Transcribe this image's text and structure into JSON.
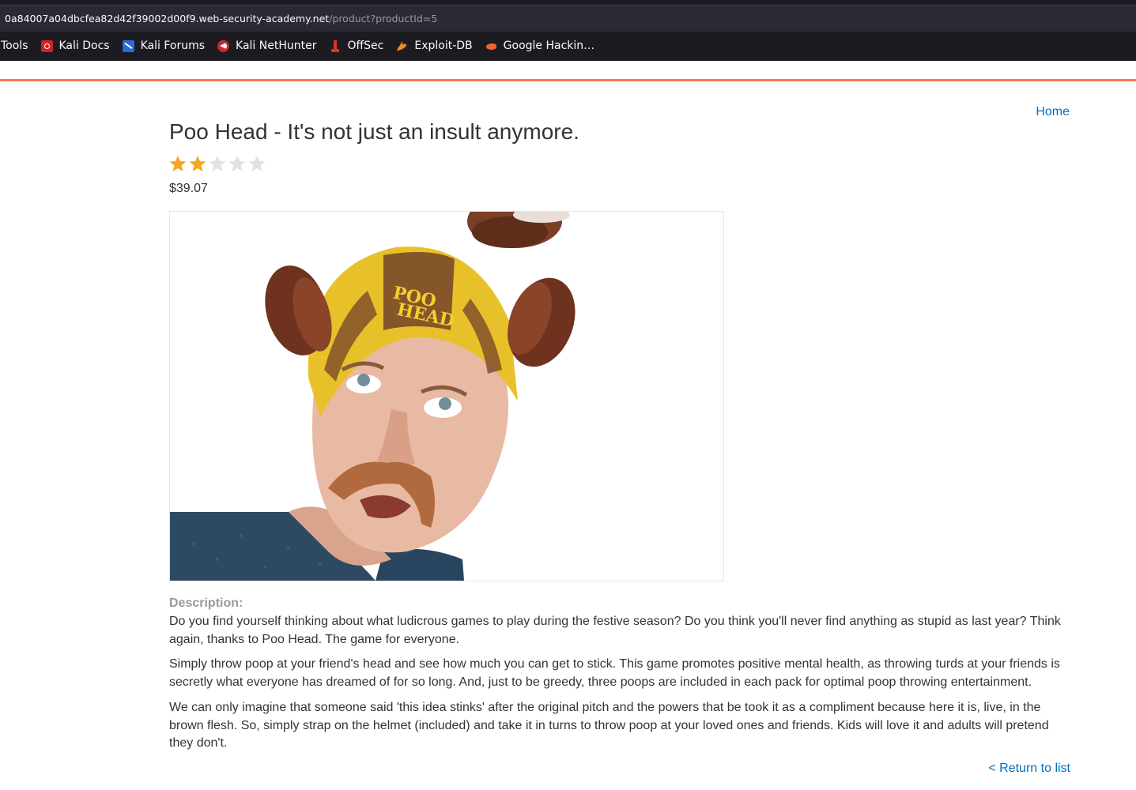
{
  "browser": {
    "url_host": "0a84007a04dbcfea82d42f39002d00f9.web-security-academy.net",
    "url_path": "/product?productId=5",
    "bookmarks": [
      {
        "label": "Tools",
        "icon": "none"
      },
      {
        "label": "Kali Docs",
        "icon": "kali-docs-icon"
      },
      {
        "label": "Kali Forums",
        "icon": "kali-forums-icon"
      },
      {
        "label": "Kali NetHunter",
        "icon": "kali-nethunter-icon"
      },
      {
        "label": "OffSec",
        "icon": "offsec-icon"
      },
      {
        "label": "Exploit-DB",
        "icon": "exploit-db-icon"
      },
      {
        "label": "Google Hackin…",
        "icon": "google-hacking-db-icon"
      }
    ]
  },
  "header": {
    "home_label": "Home",
    "accent_color": "#ff6633"
  },
  "product": {
    "title": "Poo Head - It's not just an insult anymore.",
    "rating": 2,
    "rating_max": 5,
    "price": "$39.07",
    "image_alt": "Man wearing a yellow and brown Poo Head helmet looking up",
    "helmet_text_line1": "POO",
    "helmet_text_line2": "HEAD",
    "description_label": "Description:",
    "description": [
      "Do you find yourself thinking about what ludicrous games to play during the festive season? Do you think you'll never find anything as stupid as last year? Think again, thanks to Poo Head. The game for everyone.",
      "Simply throw poop at your friend's head and see how much you can get to stick. This game promotes positive mental health, as throwing turds at your friends is secretly what everyone has dreamed of for so long. And, just to be greedy, three poops are included in each pack for optimal poop throwing entertainment.",
      "We can only imagine that someone said 'this idea stinks' after the original pitch and the powers that be took it as a compliment because here it is, live, in the brown flesh. So, simply strap on the helmet (included) and take it in turns to throw poop at your loved ones and friends. Kids will love it and adults will pretend they don't."
    ]
  },
  "footer": {
    "return_label": "< Return to list"
  },
  "colors": {
    "link": "#0071bc",
    "star_filled": "#f5a623",
    "star_empty": "#e2e2e2"
  }
}
